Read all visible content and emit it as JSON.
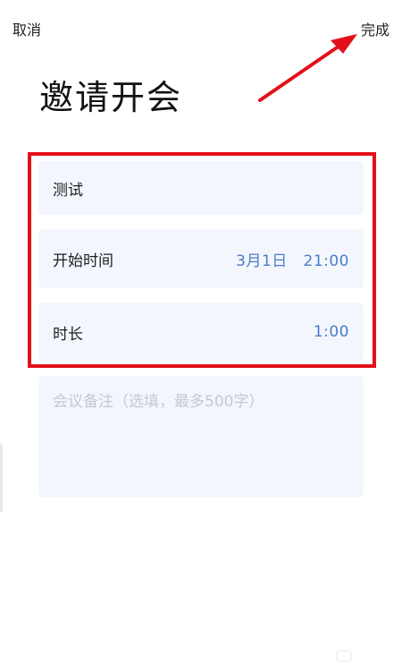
{
  "nav": {
    "cancel_label": "取消",
    "done_label": "完成"
  },
  "page": {
    "title": "邀请开会"
  },
  "form": {
    "topic": "测试",
    "start_time": {
      "label": "开始时间",
      "value": "3月1日   21:00"
    },
    "duration": {
      "label": "时长",
      "value": "1:00"
    },
    "notes": {
      "placeholder": "会议备注（选填，最多500字）"
    }
  },
  "annotations": {
    "highlight_color": "#e3101a",
    "arrow_color": "#e3101a"
  },
  "colors": {
    "field_background": "#f3f6fd",
    "value_text": "#4b7cc8",
    "placeholder_text": "#c3c8d2"
  }
}
